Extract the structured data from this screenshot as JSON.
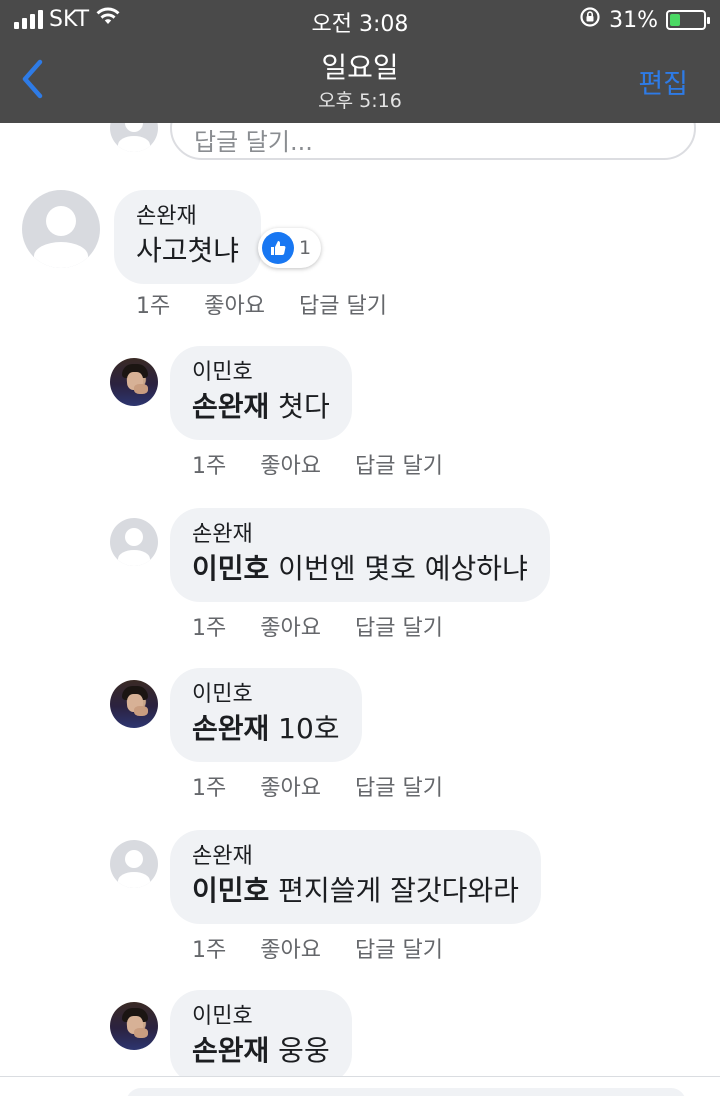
{
  "status_bar": {
    "carrier": "SKT",
    "time": "오전 3:08",
    "battery_percent_label": "31%",
    "battery_level": 0.31
  },
  "nav": {
    "title": "일요일",
    "subtitle": "오후 5:16",
    "edit_label": "편집"
  },
  "reply_box": {
    "placeholder": "답글 달기..."
  },
  "comments": [
    {
      "author": "손완재",
      "mention": "",
      "text": "사고쳣냐",
      "age": "1주",
      "like_label": "좋아요",
      "reply_label": "답글 달기",
      "reaction_count": "1"
    },
    {
      "author": "이민호",
      "mention": "손완재",
      "text": " 쳣다",
      "age": "1주",
      "like_label": "좋아요",
      "reply_label": "답글 달기"
    },
    {
      "author": "손완재",
      "mention": "이민호",
      "text": " 이번엔 몇호 예상하냐",
      "age": "1주",
      "like_label": "좋아요",
      "reply_label": "답글 달기"
    },
    {
      "author": "이민호",
      "mention": "손완재",
      "text": " 10호",
      "age": "1주",
      "like_label": "좋아요",
      "reply_label": "답글 달기"
    },
    {
      "author": "손완재",
      "mention": "이민호",
      "text": " 편지쓸게 잘갓다와라",
      "age": "1주",
      "like_label": "좋아요",
      "reply_label": "답글 달기"
    },
    {
      "author": "이민호",
      "mention": "손완재",
      "text": " 웅웅",
      "age": "",
      "like_label": "",
      "reply_label": ""
    }
  ],
  "colors": {
    "nav_bg": "#4a4a4a",
    "edit_accent": "#2e7be6",
    "bubble_bg": "#f0f2f5",
    "like_blue": "#1877f2",
    "battery_green": "#4cd964"
  }
}
